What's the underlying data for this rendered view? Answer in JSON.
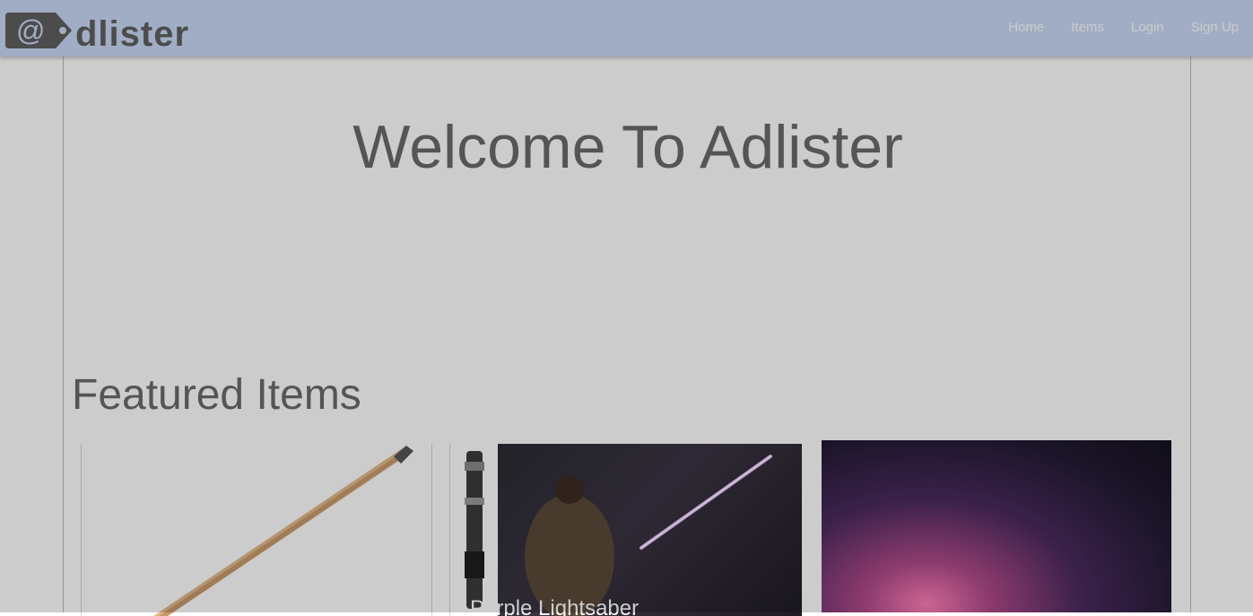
{
  "navbar": {
    "logo_text": "dlister",
    "links": [
      "Home",
      "Items",
      "Login",
      "Sign Up"
    ]
  },
  "hero": {
    "title": "Welcome To Adlister"
  },
  "featured": {
    "title": "Featured Items",
    "items": [
      {
        "title": "",
        "image": "pencil-image"
      },
      {
        "title": "Purple Lightsaber",
        "image": "lightsaber-image"
      },
      {
        "title": "",
        "image": "galaxy-image"
      }
    ]
  },
  "colors": {
    "navbar_bg": "#c9d9f5",
    "logo_gray": "#5f5f5f",
    "heading_gray": "#6b6b6b",
    "overlay": "rgba(0,0,0,0.2)"
  }
}
